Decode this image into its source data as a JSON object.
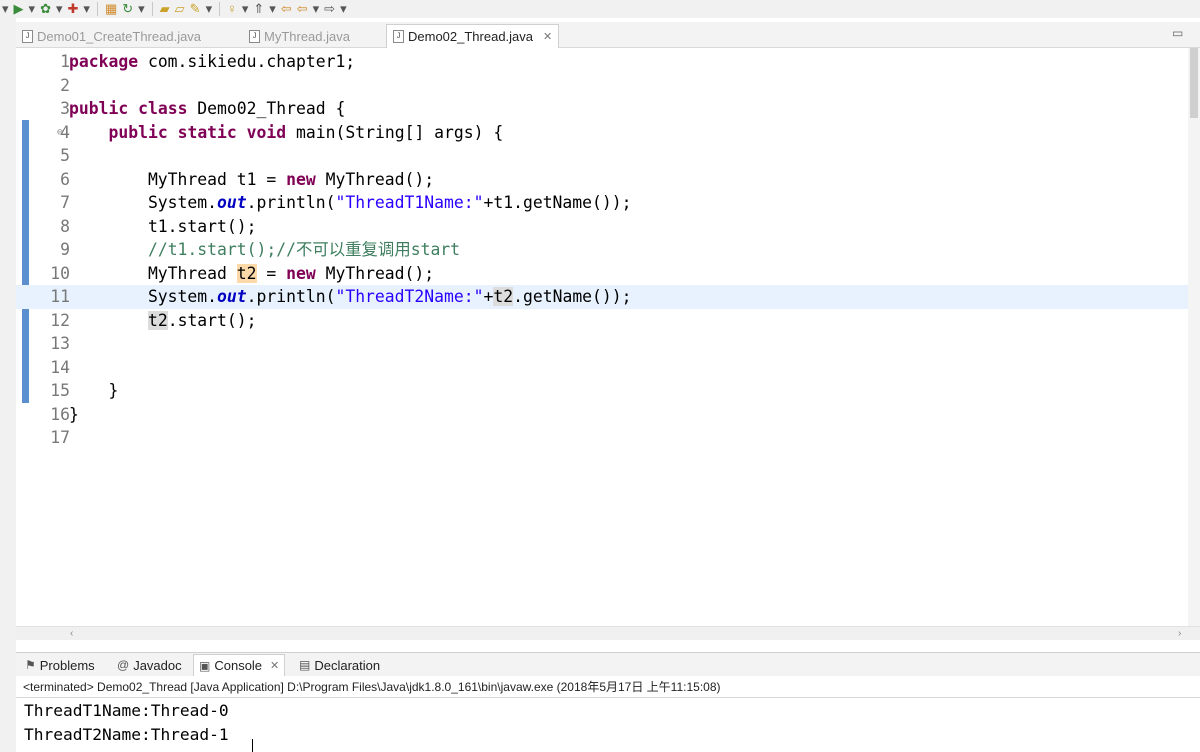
{
  "toolbar": {
    "icons": [
      "dropdown-arrow",
      "run-icon",
      "dropdown-arrow",
      "debug-icon",
      "dropdown-arrow",
      "external-tools-icon",
      "dropdown-arrow",
      "grid-icon",
      "refresh-icon",
      "dropdown-arrow",
      "open-folder-icon",
      "open-file-icon",
      "pencil-icon",
      "dropdown-arrow",
      "bulb-icon",
      "dropdown-arrow",
      "up-icon",
      "dropdown-arrow",
      "back-icon",
      "dropdown-arrow",
      "forward-icon",
      "dropdown-arrow",
      "next-icon",
      "dropdown-arrow"
    ]
  },
  "editor_tabs": [
    {
      "label": "Demo01_CreateThread.java",
      "active": false
    },
    {
      "label": "MyThread.java",
      "active": false
    },
    {
      "label": "Demo02_Thread.java",
      "active": true
    }
  ],
  "editor": {
    "lines": [
      {
        "n": "1",
        "tokens": [
          {
            "t": "package",
            "c": "kw"
          },
          {
            "t": " com.sikiedu.chapter1;"
          }
        ]
      },
      {
        "n": "2",
        "tokens": []
      },
      {
        "n": "3",
        "tokens": [
          {
            "t": "public",
            "c": "kw"
          },
          {
            "t": " "
          },
          {
            "t": "class",
            "c": "kw"
          },
          {
            "t": " Demo02_Thread {"
          }
        ]
      },
      {
        "n": "4",
        "fold": true,
        "tokens": [
          {
            "t": "    "
          },
          {
            "t": "public",
            "c": "kw"
          },
          {
            "t": " "
          },
          {
            "t": "static",
            "c": "kw"
          },
          {
            "t": " "
          },
          {
            "t": "void",
            "c": "kw"
          },
          {
            "t": " main(String[] args) {"
          }
        ]
      },
      {
        "n": "5",
        "tokens": []
      },
      {
        "n": "6",
        "tokens": [
          {
            "t": "        MyThread t1 = "
          },
          {
            "t": "new",
            "c": "kw"
          },
          {
            "t": " MyThread();"
          }
        ]
      },
      {
        "n": "7",
        "tokens": [
          {
            "t": "        System."
          },
          {
            "t": "out",
            "c": "fld"
          },
          {
            "t": ".println("
          },
          {
            "t": "\"ThreadT1Name:\"",
            "c": "str"
          },
          {
            "t": "+t1.getName());"
          }
        ]
      },
      {
        "n": "8",
        "tokens": [
          {
            "t": "        t1.start();"
          }
        ]
      },
      {
        "n": "9",
        "tokens": [
          {
            "t": "        "
          },
          {
            "t": "//t1.start();//不可以重复调用start",
            "c": "cmt"
          }
        ]
      },
      {
        "n": "10",
        "tokens": [
          {
            "t": "        MyThread "
          },
          {
            "t": "t2",
            "c": "occ"
          },
          {
            "t": " = "
          },
          {
            "t": "new",
            "c": "kw"
          },
          {
            "t": " MyThread();"
          }
        ]
      },
      {
        "n": "11",
        "current": true,
        "tokens": [
          {
            "t": "        System."
          },
          {
            "t": "out",
            "c": "fld"
          },
          {
            "t": ".println("
          },
          {
            "t": "\"ThreadT2Name:\"",
            "c": "str"
          },
          {
            "t": "+"
          },
          {
            "t": "t2",
            "c": "occ2"
          },
          {
            "t": ".getName());"
          }
        ]
      },
      {
        "n": "12",
        "tokens": [
          {
            "t": "        "
          },
          {
            "t": "t2",
            "c": "occ2"
          },
          {
            "t": ".start();"
          }
        ]
      },
      {
        "n": "13",
        "tokens": []
      },
      {
        "n": "14",
        "tokens": []
      },
      {
        "n": "15",
        "tokens": [
          {
            "t": "    }"
          }
        ]
      },
      {
        "n": "16",
        "tokens": [
          {
            "t": "}"
          }
        ]
      },
      {
        "n": "17",
        "tokens": []
      }
    ]
  },
  "bottom_tabs": [
    {
      "label": "Problems",
      "icon": "problems-icon",
      "active": false
    },
    {
      "label": "Javadoc",
      "icon": "javadoc-icon",
      "active": false
    },
    {
      "label": "Console",
      "icon": "console-icon",
      "active": true
    },
    {
      "label": "Declaration",
      "icon": "declaration-icon",
      "active": false
    }
  ],
  "console": {
    "status": "<terminated> Demo02_Thread [Java Application] D:\\Program Files\\Java\\jdk1.8.0_161\\bin\\javaw.exe (2018年5月17日 上午11:15:08)",
    "lines": [
      "ThreadT1Name:Thread-0",
      "ThreadT2Name:Thread-1"
    ]
  }
}
